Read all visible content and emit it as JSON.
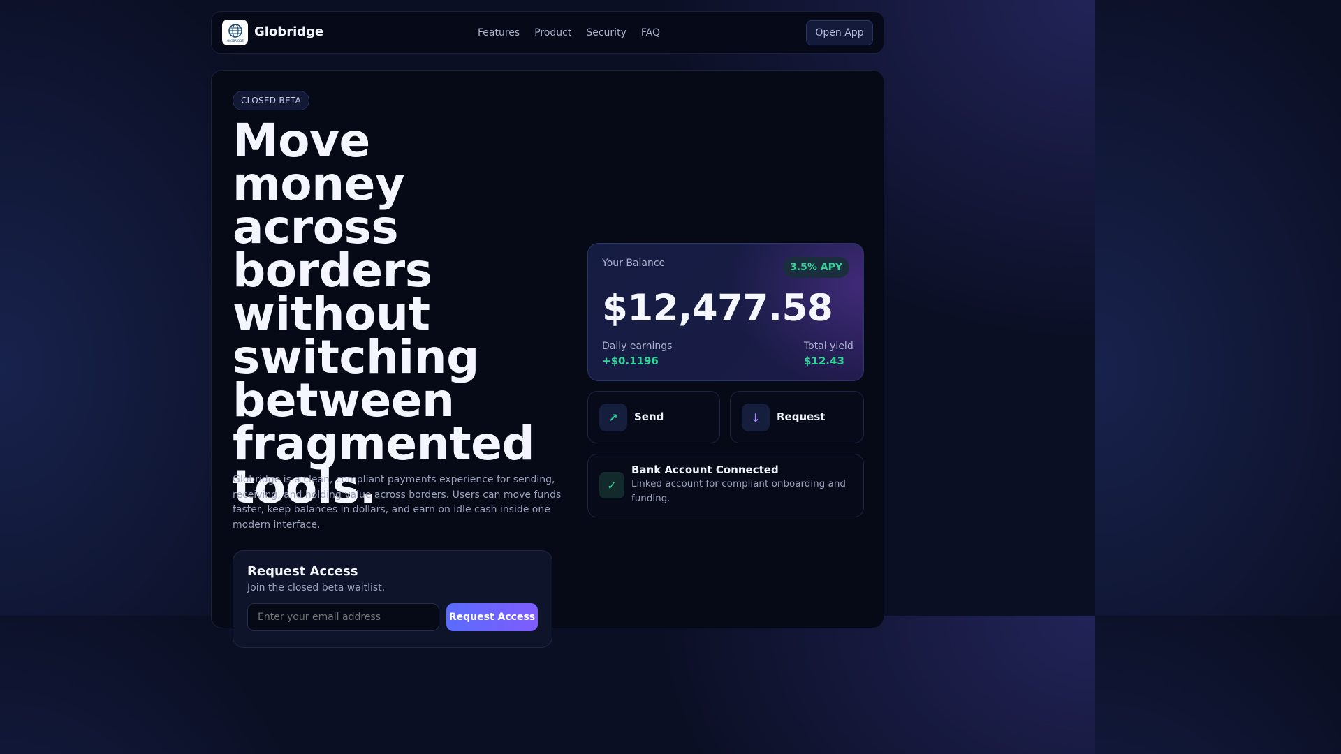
{
  "nav": {
    "brand": "Globridge",
    "logo_text": "GLOBRIDGE",
    "links": [
      "Features",
      "Product",
      "Security",
      "FAQ"
    ],
    "open_app": "Open App"
  },
  "hero": {
    "badge": "CLOSED BETA",
    "title": "Move money across borders without switching between fragmented tools.",
    "description": "Globridge is a clean, compliant payments experience for sending, receiving, and holding value across borders. Users can move funds faster, keep balances in dollars, and earn on idle cash inside one modern interface."
  },
  "access": {
    "title": "Request Access",
    "subtitle": "Join the closed beta waitlist.",
    "email_placeholder": "Enter your email address",
    "button": "Request Access"
  },
  "balance": {
    "label": "Your Balance",
    "apy": "3.5% APY",
    "amount": "$12,477.58",
    "daily_label": "Daily earnings",
    "daily_value": "+$0.1196",
    "yield_label": "Total yield",
    "yield_value": "$12.43"
  },
  "actions": {
    "send": {
      "icon": "arrow-up-right-icon",
      "glyph": "↗",
      "label": "Send",
      "color": "#34d399"
    },
    "request": {
      "icon": "arrow-down-icon",
      "glyph": "↓",
      "label": "Request",
      "color": "#a78bfa"
    }
  },
  "bank": {
    "icon": "check-icon",
    "glyph": "✓",
    "title": "Bank Account Connected",
    "description": "Linked account for compliant onboarding and funding."
  },
  "colors": {
    "accent_green": "#34d399",
    "accent_purple": "#7f5cff",
    "accent_blue": "#5a6cff"
  }
}
